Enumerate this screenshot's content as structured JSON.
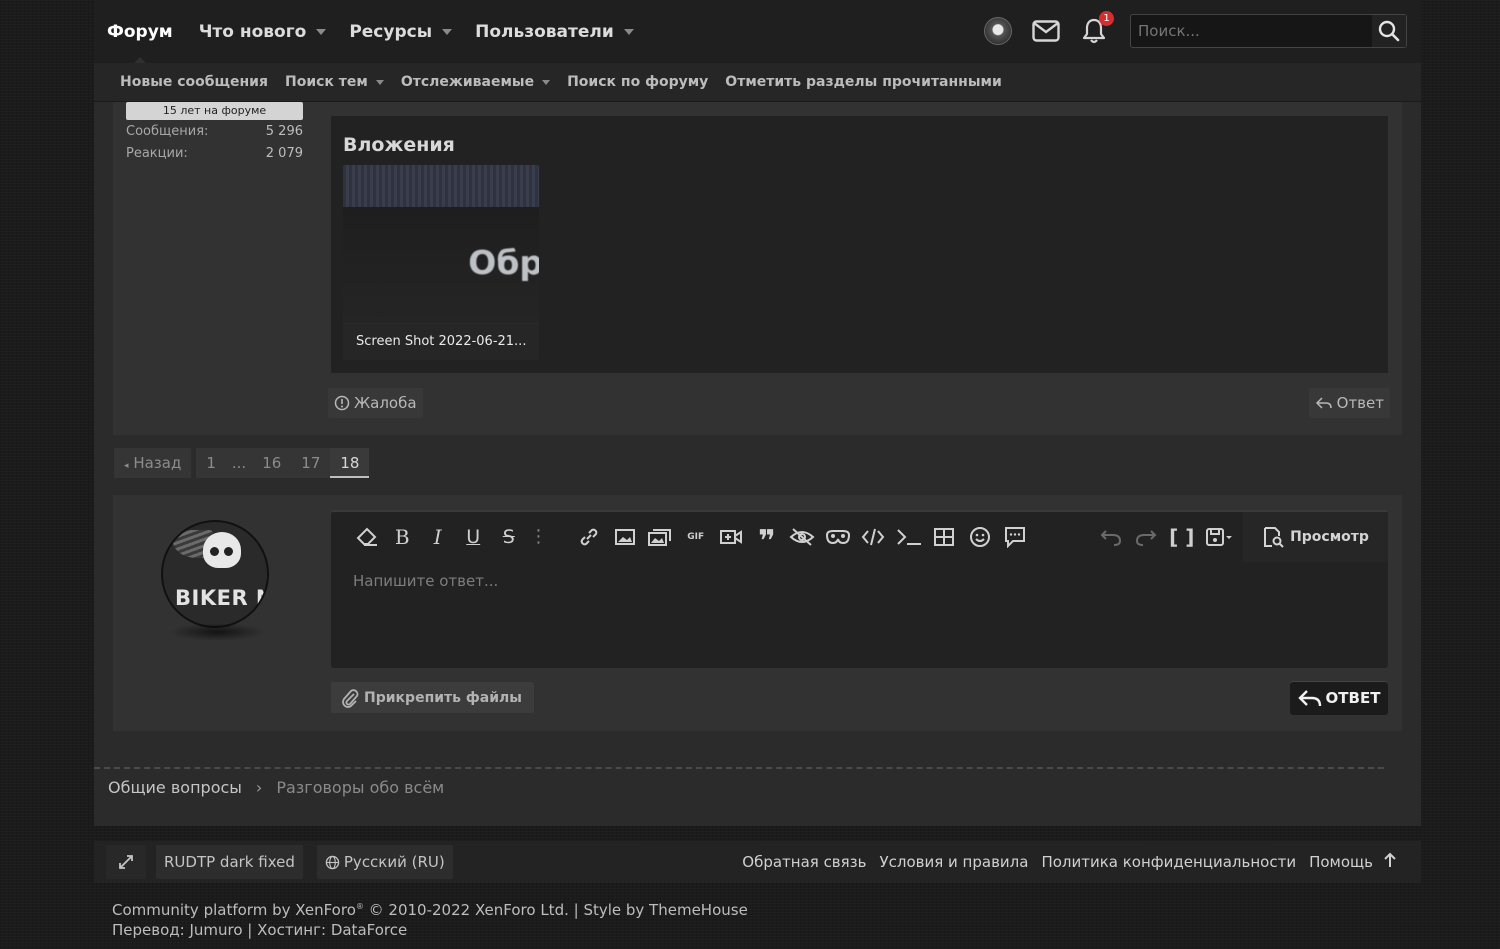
{
  "nav": {
    "items": [
      {
        "label": "Форум",
        "active": true,
        "dropdown": false
      },
      {
        "label": "Что нового",
        "active": false,
        "dropdown": true
      },
      {
        "label": "Ресурсы",
        "active": false,
        "dropdown": true
      },
      {
        "label": "Пользователи",
        "active": false,
        "dropdown": true
      }
    ],
    "notification_count": "1",
    "search_placeholder": "Поиск..."
  },
  "subnav": {
    "items": [
      {
        "label": "Новые сообщения",
        "dropdown": false
      },
      {
        "label": "Поиск тем",
        "dropdown": true
      },
      {
        "label": "Отслеживаемые",
        "dropdown": true
      },
      {
        "label": "Поиск по форуму",
        "dropdown": false
      },
      {
        "label": "Отметить разделы прочитанными",
        "dropdown": false
      }
    ]
  },
  "post": {
    "user_badge": "15 лет на форуме",
    "stats": [
      {
        "label": "Сообщения:",
        "value": "5 296"
      },
      {
        "label": "Реакции:",
        "value": "2 079"
      }
    ],
    "attachments_title": "Вложения",
    "attachment": {
      "caption": "Screen Shot 2022-06-21...",
      "preview_text": "Обр"
    },
    "report_label": "Жалоба",
    "reply_label": "Ответ"
  },
  "pagination": {
    "prev_label": "Назад",
    "pages": [
      "1",
      "...",
      "16",
      "17",
      "18"
    ],
    "current": "18"
  },
  "reply": {
    "avatar_text": "BIKER N",
    "placeholder": "Напишите ответ...",
    "preview_label": "Просмотр",
    "attach_label": "Прикрепить файлы",
    "submit_label": "ОТВЕТ",
    "toolbar_gif_label": "GIF"
  },
  "breadcrumb": {
    "items": [
      "Общие вопросы",
      "Разговоры обо всём"
    ]
  },
  "footer": {
    "style_label": "RUDTP dark fixed",
    "language_label": "Русский (RU)",
    "links": [
      "Обратная связь",
      "Условия и правила",
      "Политика конфиденциальности",
      "Помощь"
    ],
    "copyright_prefix": "Community platform by XenForo",
    "copyright_reg": "®",
    "copyright_suffix": " © 2010-2022 XenForo Ltd. | Style by ThemeHouse",
    "credits": "Перевод: Jumuro | Хостинг: DataForce"
  },
  "colors": {
    "page_bg": "#1b1b1b",
    "content_bg": "#2b2b2b",
    "block_bg": "#323232",
    "editor_bg": "#222222",
    "badge_red": "#d32f2f"
  }
}
